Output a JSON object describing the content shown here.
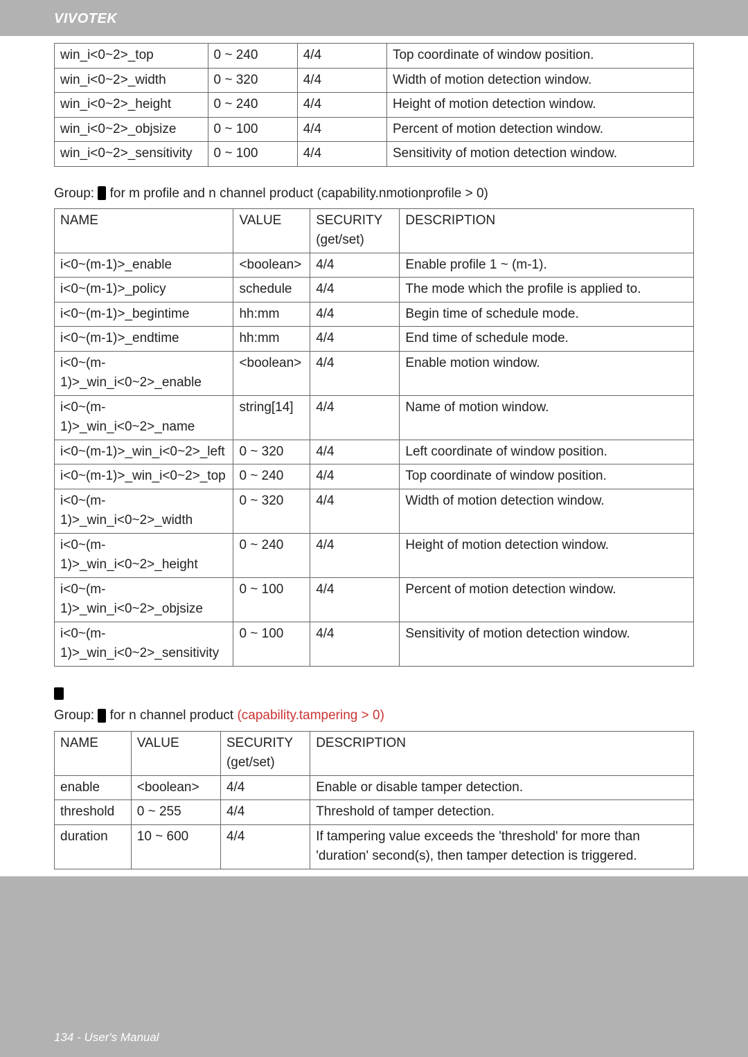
{
  "brand": "VIVOTEK",
  "footer": "134 - User's Manual",
  "table1": {
    "rows": [
      {
        "name": "win_i<0~2>_top",
        "value": "0 ~ 240",
        "sec": "4/4",
        "desc": "Top coordinate of window position."
      },
      {
        "name": "win_i<0~2>_width",
        "value": "0 ~ 320",
        "sec": "4/4",
        "desc": "Width of motion detection window."
      },
      {
        "name": "win_i<0~2>_height",
        "value": "0 ~ 240",
        "sec": "4/4",
        "desc": "Height of motion detection window."
      },
      {
        "name": "win_i<0~2>_objsize",
        "value": "0 ~ 100",
        "sec": "4/4",
        "desc": "Percent of motion detection window."
      },
      {
        "name": "win_i<0~2>_sensitivity",
        "value": "0 ~ 100",
        "sec": "4/4",
        "desc": "Sensitivity of motion detection window."
      }
    ]
  },
  "section2": {
    "prefix": "Group:",
    "suffix": " for m profile and n channel product (capability.nmotionprofile > 0)"
  },
  "table2": {
    "headers": {
      "name": "NAME",
      "value": "VALUE",
      "sec": "SECURITY (get/set)",
      "desc": "DESCRIPTION"
    },
    "rows": [
      {
        "name": "i<0~(m-1)>_enable",
        "value": "<boolean>",
        "sec": "4/4",
        "desc": "Enable profile 1 ~ (m-1)."
      },
      {
        "name": "i<0~(m-1)>_policy",
        "value": "schedule",
        "sec": "4/4",
        "desc": "The mode which the profile is applied to."
      },
      {
        "name": "i<0~(m-1)>_begintime",
        "value": "hh:mm",
        "sec": "4/4",
        "desc": "Begin time of schedule mode."
      },
      {
        "name": "i<0~(m-1)>_endtime",
        "value": "hh:mm",
        "sec": "4/4",
        "desc": "End time of schedule mode."
      },
      {
        "name": "i<0~(m-1)>_win_i<0~2>_enable",
        "value": "<boolean>",
        "sec": "4/4",
        "desc": "Enable motion window."
      },
      {
        "name": "i<0~(m-1)>_win_i<0~2>_name",
        "value": "string[14]",
        "sec": "4/4",
        "desc": "Name of motion window."
      },
      {
        "name": "i<0~(m-1)>_win_i<0~2>_left",
        "value": "0 ~ 320",
        "sec": "4/4",
        "desc": "Left coordinate of window position."
      },
      {
        "name": "i<0~(m-1)>_win_i<0~2>_top",
        "value": "0 ~ 240",
        "sec": "4/4",
        "desc": "Top coordinate of window position."
      },
      {
        "name": "i<0~(m-1)>_win_i<0~2>_width",
        "value": "0 ~ 320",
        "sec": "4/4",
        "desc": "Width of motion detection window."
      },
      {
        "name": "i<0~(m-1)>_win_i<0~2>_height",
        "value": "0 ~ 240",
        "sec": "4/4",
        "desc": "Height of motion detection window."
      },
      {
        "name": "i<0~(m-1)>_win_i<0~2>_objsize",
        "value": "0 ~ 100",
        "sec": "4/4",
        "desc": "Percent of motion detection window."
      },
      {
        "name": "i<0~(m-1)>_win_i<0~2>_sensitivity",
        "value": "0 ~ 100",
        "sec": "4/4",
        "desc": "Sensitivity of motion detection window."
      }
    ]
  },
  "section3": {
    "prefix": "Group:",
    "mid": " for n channel product ",
    "red": "(capability.tampering > 0)"
  },
  "table3": {
    "headers": {
      "name": "NAME",
      "value": "VALUE",
      "sec": "SECURITY (get/set)",
      "desc": "DESCRIPTION"
    },
    "rows": [
      {
        "name": "enable",
        "value": "<boolean>",
        "sec": "4/4",
        "desc": "Enable or disable tamper detection."
      },
      {
        "name": "threshold",
        "value": "0 ~ 255",
        "sec": "4/4",
        "desc": "Threshold of tamper detection."
      },
      {
        "name": "duration",
        "value": "10 ~ 600",
        "sec": "4/4",
        "desc": "If tampering value exceeds the 'threshold' for more than 'duration' second(s), then tamper detection is triggered."
      }
    ]
  }
}
